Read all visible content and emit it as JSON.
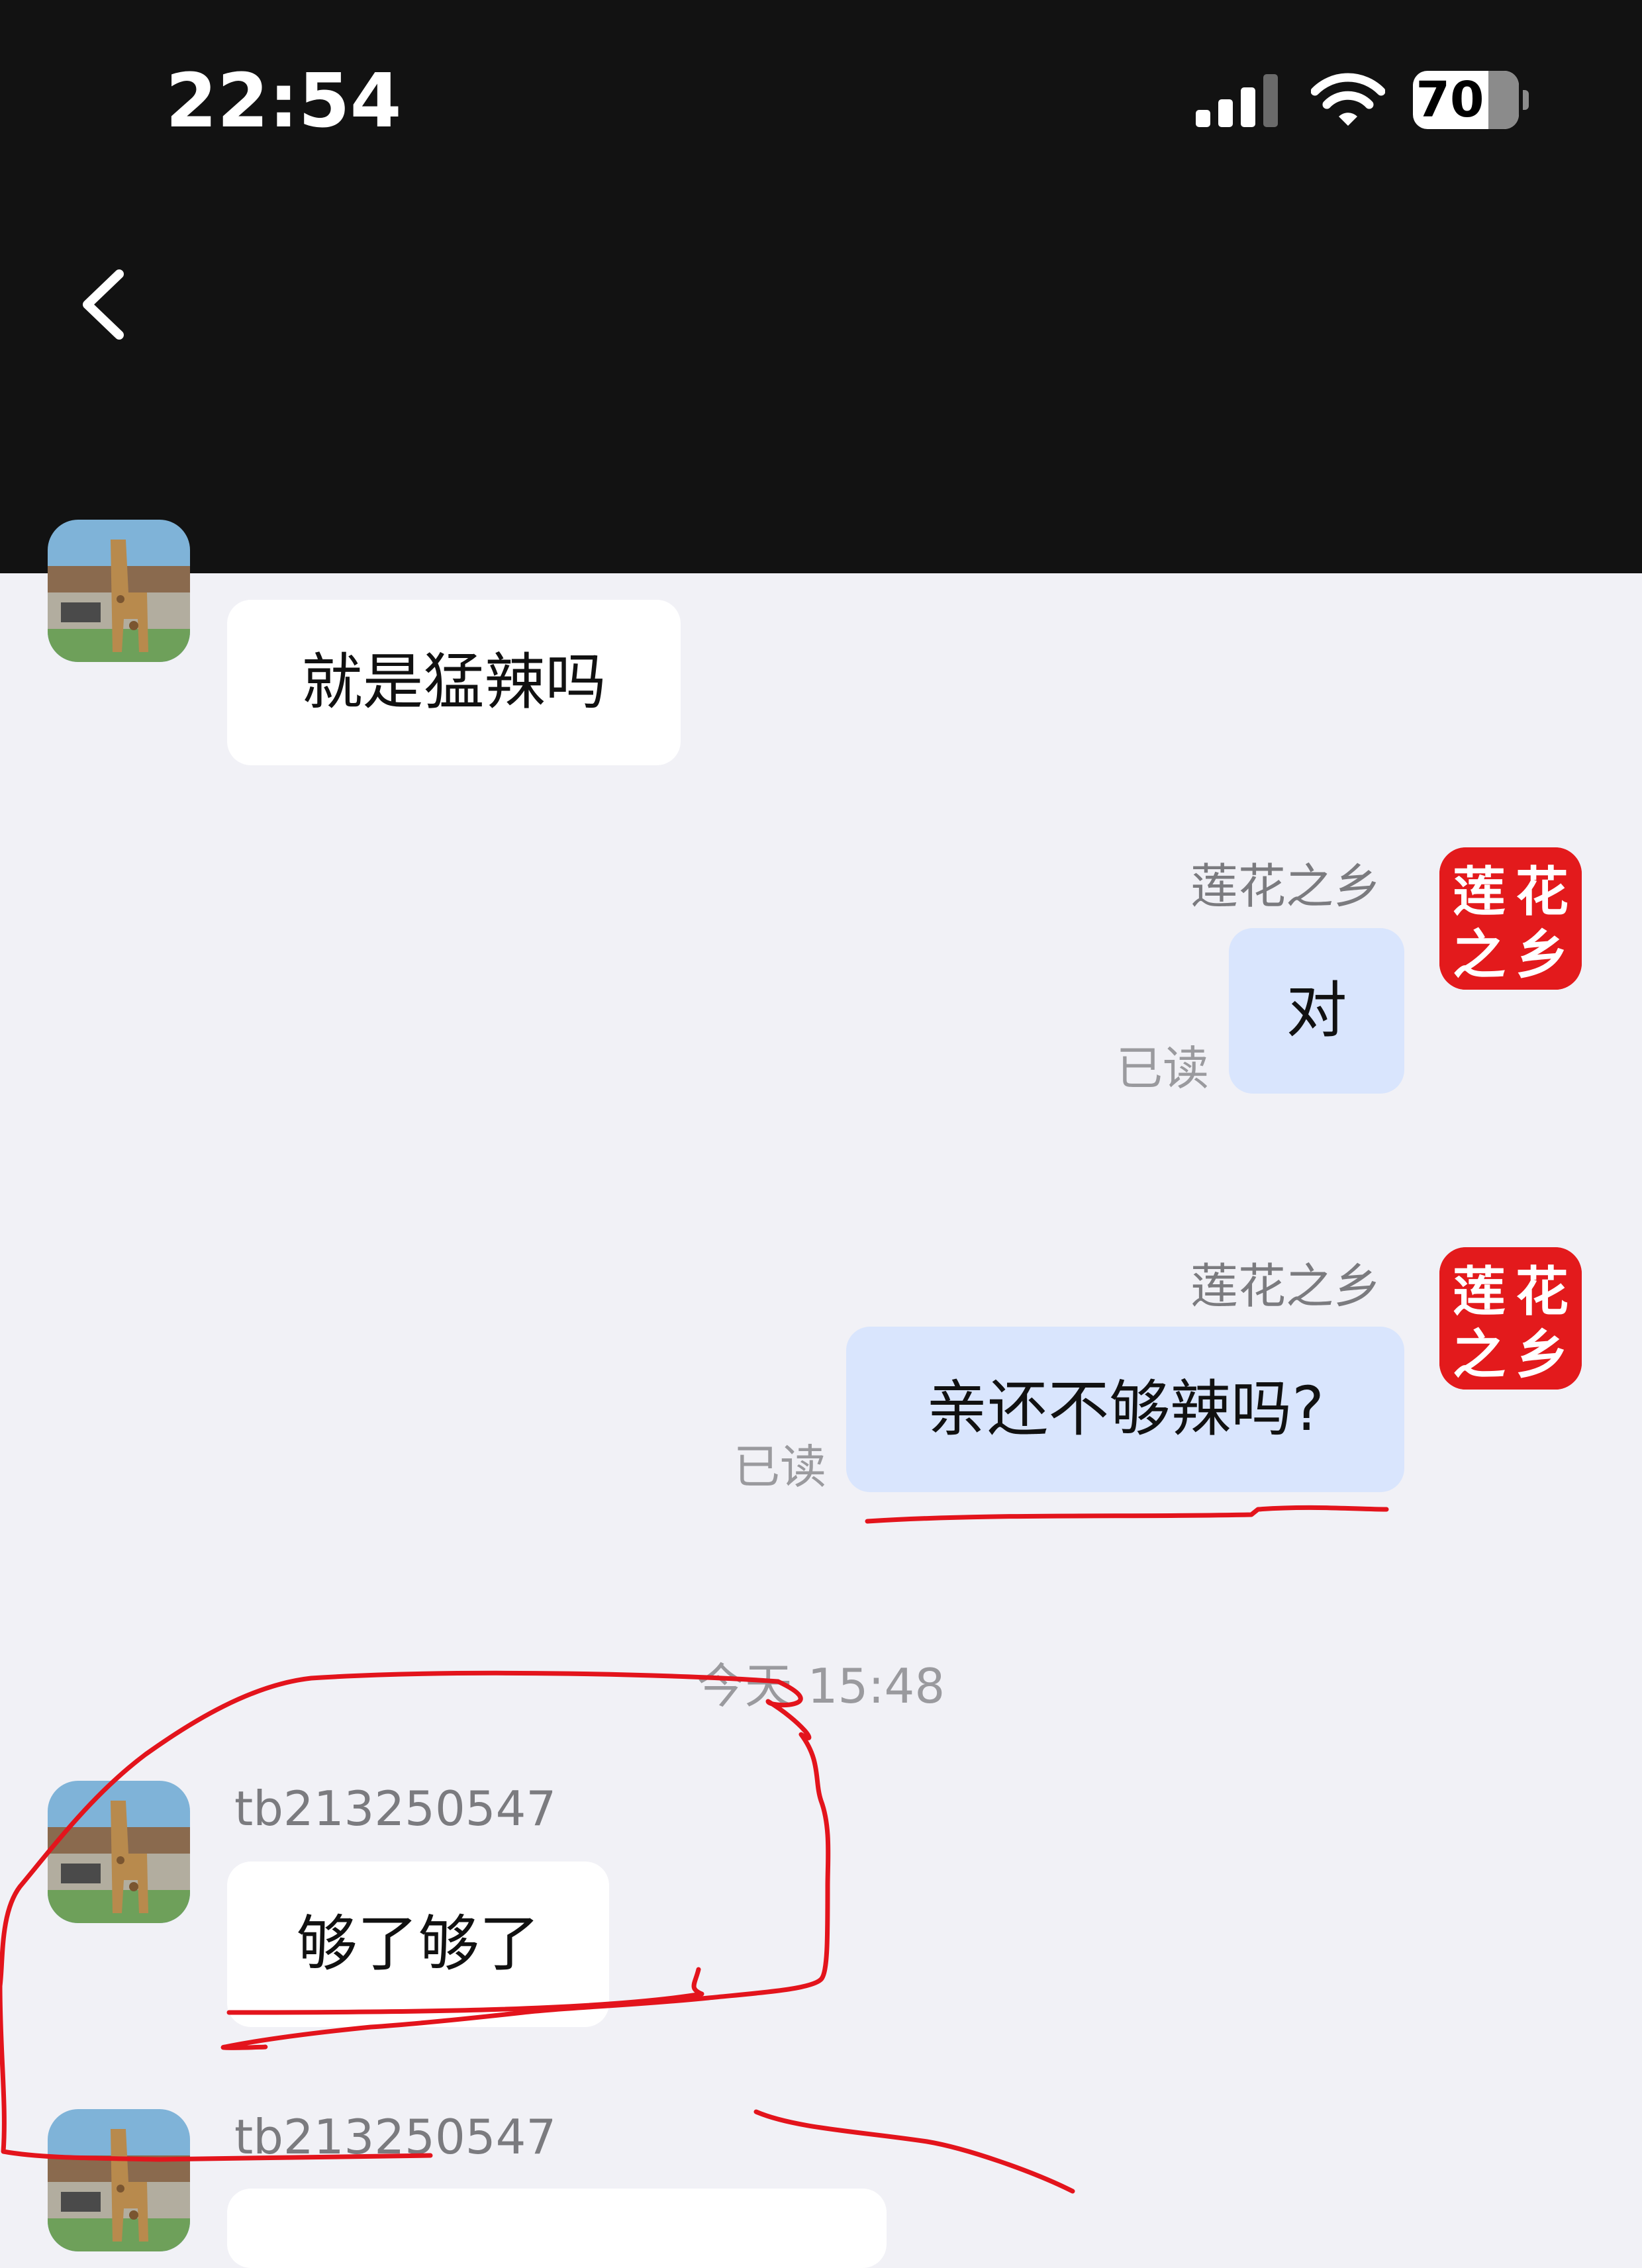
{
  "status_bar": {
    "time": "22:54",
    "battery": "70"
  },
  "header": {
    "back_icon": "chevron-left-icon"
  },
  "chat": {
    "messages": [
      {
        "id": "m1",
        "direction": "incoming",
        "text": "就是猛辣吗"
      },
      {
        "id": "m2",
        "direction": "outgoing",
        "sender": "莲花之乡",
        "text": "对",
        "status": "已读"
      },
      {
        "id": "m3",
        "direction": "outgoing",
        "sender": "莲花之乡",
        "text": "亲还不够辣吗?",
        "status": "已读"
      },
      {
        "id": "m4",
        "direction": "incoming",
        "sender": "tb213250547",
        "text": "够了够了"
      },
      {
        "id": "m5",
        "direction": "incoming",
        "sender": "tb213250547",
        "text": ""
      }
    ],
    "timestamp": "今天 15:48",
    "shop_avatar_text": "莲花之乡"
  },
  "colors": {
    "header_bg": "#121212",
    "chat_bg": "#f1f1f6",
    "incoming_bubble": "#ffffff",
    "outgoing_bubble": "#d9e5fd",
    "shop_logo_red": "#e31a1c",
    "annotation_ink": "#e3141c"
  }
}
